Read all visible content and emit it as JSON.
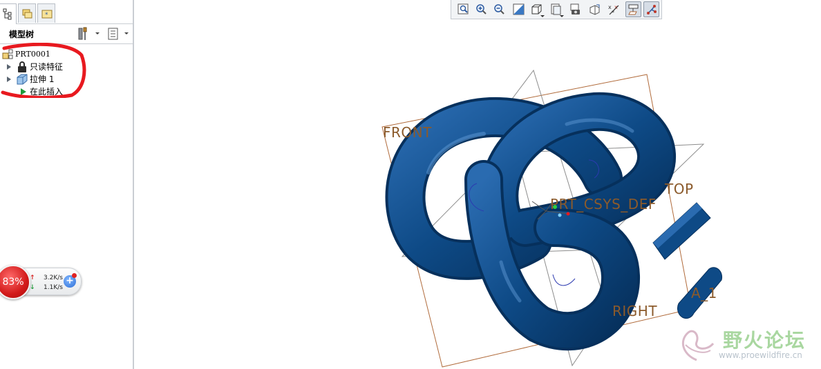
{
  "model_tree": {
    "title": "模型树",
    "tabs": [
      {
        "name": "model-tree-tab-icon",
        "active": true
      },
      {
        "name": "folder-browser-tab-icon",
        "active": false
      },
      {
        "name": "favorites-tab-icon",
        "active": false
      }
    ],
    "items": [
      {
        "label": "PRT0001",
        "icon": "part-icon",
        "expander": false
      },
      {
        "label": "只读特征",
        "icon": "lock-icon",
        "expander": true
      },
      {
        "label": "拉伸 1",
        "icon": "extrude-icon",
        "expander": true
      },
      {
        "label": "在此插入",
        "icon": "insert-arrow-icon",
        "expander": false
      }
    ]
  },
  "network_meter": {
    "percent": "83%",
    "upload": "3.2K/s",
    "download": "1.1K/s"
  },
  "viewport": {
    "datum_labels": {
      "front": "FRONT",
      "top": "TOP",
      "right": "RIGHT",
      "csys": "PRT_CSYS_DEF",
      "axis": "A_1"
    },
    "colors": {
      "model": "#0e4a86",
      "datum_plane": "#b06a3a",
      "annotation_red": "#e8191f"
    }
  },
  "toolbar": {
    "buttons": [
      "refit-icon",
      "zoom-in-icon",
      "zoom-out-icon",
      "repaint-icon",
      "display-style-icon",
      "saved-views-icon",
      "view-manager-icon",
      "perspective-icon",
      "annotation-display-icon",
      "datum-plane-display-icon",
      "csys-display-icon"
    ]
  },
  "watermark": {
    "text": "野火论坛",
    "url": "www.proewildfire.cn"
  }
}
